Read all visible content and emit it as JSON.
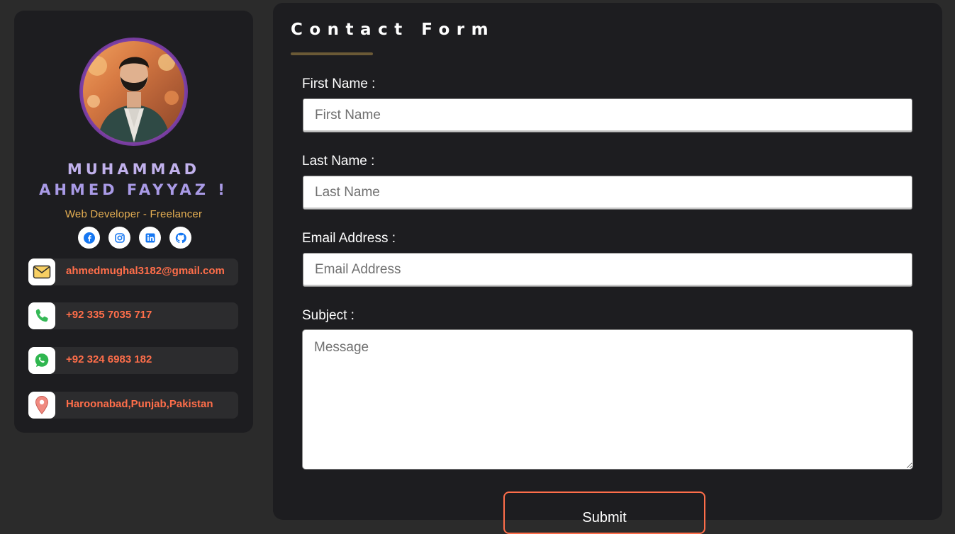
{
  "profile": {
    "name_line1": "MUHAMMAD",
    "name_line2": "AHMED FAYYAZ !",
    "role": "Web Developer - Freelancer",
    "socials": [
      {
        "icon": "facebook-icon"
      },
      {
        "icon": "instagram-icon"
      },
      {
        "icon": "linkedin-icon"
      },
      {
        "icon": "github-icon"
      }
    ],
    "contacts": [
      {
        "icon": "mail-icon",
        "text": "ahmedmughal3182@gmail.com"
      },
      {
        "icon": "phone-icon",
        "text": "+92 335 7035 717"
      },
      {
        "icon": "whatsapp-icon",
        "text": "+92 324 6983 182"
      },
      {
        "icon": "location-pin-icon",
        "text": "Haroonabad,Punjab,Pakistan"
      }
    ]
  },
  "form": {
    "title": "Contact Form",
    "first_name": {
      "label": "First Name :",
      "placeholder": "First Name",
      "value": ""
    },
    "last_name": {
      "label": "Last Name :",
      "placeholder": "Last Name",
      "value": ""
    },
    "email": {
      "label": "Email Address :",
      "placeholder": "Email Address",
      "value": ""
    },
    "subject": {
      "label": "Subject :",
      "placeholder": "Message",
      "value": ""
    },
    "submit_label": "Submit"
  },
  "colors": {
    "background": "#2b2b2b",
    "card": "#1d1d20",
    "accent": "#ff6e4a",
    "name": "#b3a2e6",
    "role": "#e7b053"
  }
}
